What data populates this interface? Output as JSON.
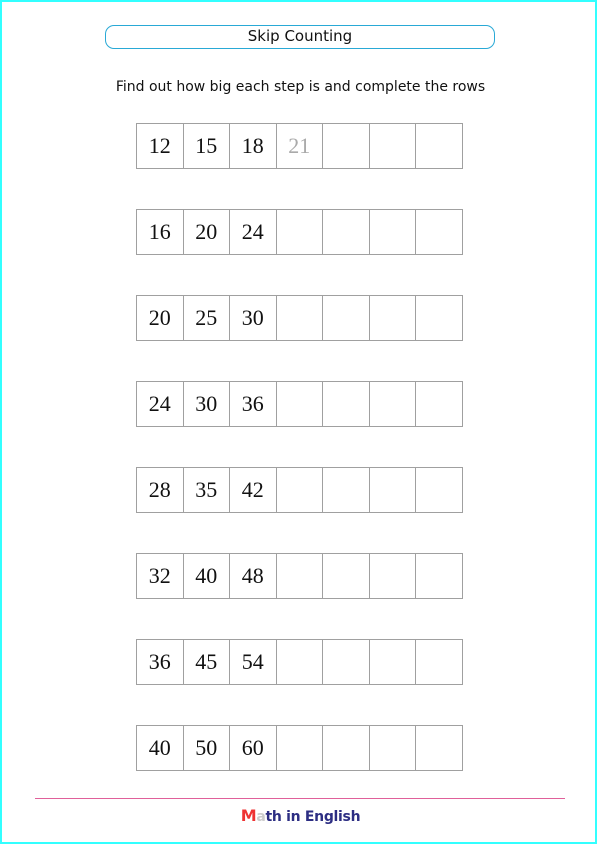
{
  "worksheet": {
    "title": "Skip Counting",
    "instructions": "Find out how big each step is and complete the rows",
    "rows": [
      {
        "cells": [
          "12",
          "15",
          "18",
          "21",
          "",
          "",
          ""
        ],
        "hint_index": 3
      },
      {
        "cells": [
          "16",
          "20",
          "24",
          "",
          "",
          "",
          ""
        ]
      },
      {
        "cells": [
          "20",
          "25",
          "30",
          "",
          "",
          "",
          ""
        ]
      },
      {
        "cells": [
          "24",
          "30",
          "36",
          "",
          "",
          "",
          ""
        ]
      },
      {
        "cells": [
          "28",
          "35",
          "42",
          "",
          "",
          "",
          ""
        ]
      },
      {
        "cells": [
          "32",
          "40",
          "48",
          "",
          "",
          "",
          ""
        ]
      },
      {
        "cells": [
          "36",
          "45",
          "54",
          "",
          "",
          "",
          ""
        ]
      },
      {
        "cells": [
          "40",
          "50",
          "60",
          "",
          "",
          "",
          ""
        ]
      }
    ]
  },
  "footer": {
    "logo_first": "M",
    "logo_second": "a",
    "logo_rest": "th in English"
  },
  "colors": {
    "page_border": "#33ffff",
    "title_border": "#29a9d6",
    "footer_line": "#e0609a",
    "logo_m": "#ee3333",
    "logo_text": "#2d2e83",
    "hint_text": "#aaaaaa"
  }
}
